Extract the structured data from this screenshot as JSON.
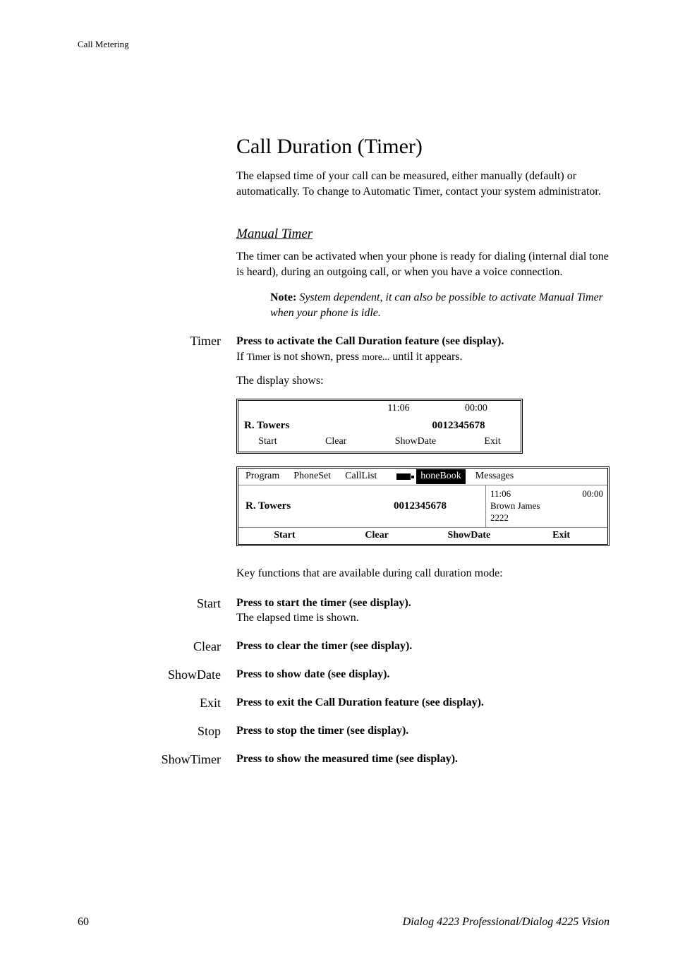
{
  "header": {
    "running": "Call Metering"
  },
  "title": "Call Duration (Timer)",
  "intro": "The elapsed time of your call can be measured, either manually (default) or automatically. To change to Automatic Timer, contact your system administrator.",
  "section_manual": {
    "heading": "Manual Timer",
    "para": "The timer can be activated when your phone is ready for dialing (internal dial tone is heard), during an outgoing call, or when you have a voice connection.",
    "note_label": "Note:",
    "note_text": "System dependent, it can also be possible to activate Manual Timer when your phone is idle."
  },
  "timer_key": {
    "label": "Timer",
    "strong": "Press to activate the Call Duration feature (see display).",
    "line2_a": "If ",
    "line2_t1": "Timer",
    "line2_b": " is not shown, press ",
    "line2_t2": "more...",
    "line2_c": " until it appears.",
    "below": "The display shows:"
  },
  "display1": {
    "time": "11:06",
    "elapsed": "00:00",
    "name": "R. Towers",
    "number": "0012345678",
    "soft": [
      "Start",
      "Clear",
      "ShowDate",
      "Exit"
    ]
  },
  "display2": {
    "tabs": [
      "Program",
      "PhoneSet",
      "CallList"
    ],
    "tab_active_suffix": "honeBook",
    "tabs_after": [
      "Messages"
    ],
    "main_name": "R. Towers",
    "main_number": "0012345678",
    "side_time": "11:06",
    "side_elapsed": "00:00",
    "side_name": "Brown James",
    "side_num": "2222",
    "soft": [
      "Start",
      "Clear",
      "ShowDate",
      "Exit"
    ]
  },
  "keyfns_intro": "Key functions that are available during call duration mode:",
  "fns": {
    "start": {
      "label": "Start",
      "strong": "Press to start the timer (see display).",
      "extra": "The elapsed time is shown."
    },
    "clear": {
      "label": "Clear",
      "strong": "Press to clear the timer (see display)."
    },
    "showdate": {
      "label": "ShowDate",
      "strong": "Press to show date (see display)."
    },
    "exit": {
      "label": "Exit",
      "strong": "Press to exit the Call Duration feature (see display)."
    },
    "stop": {
      "label": "Stop",
      "strong": "Press to stop the timer (see display)."
    },
    "showtimer": {
      "label": "ShowTimer",
      "strong": "Press to show the measured time (see display)."
    }
  },
  "footer": {
    "page": "60",
    "title": "Dialog 4223 Professional/Dialog 4225 Vision"
  }
}
